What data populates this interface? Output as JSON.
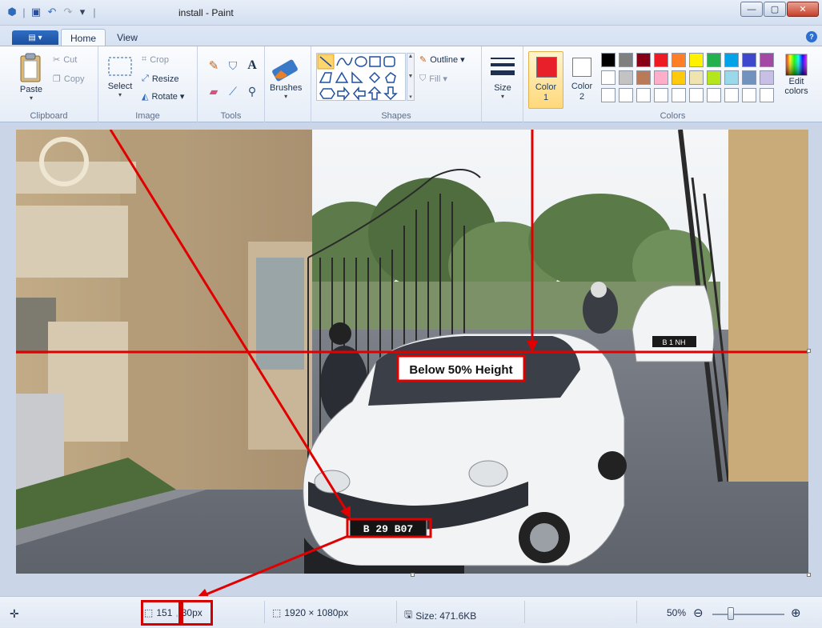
{
  "window": {
    "title": "install - Paint",
    "minimize_glyph": "—",
    "maximize_glyph": "▢",
    "close_glyph": "✕"
  },
  "quick_access": {
    "separator": "|",
    "dropdown_glyph": "▾"
  },
  "tabs": {
    "file_glyph": "▤ ▾",
    "home": "Home",
    "view": "View",
    "help_glyph": "?"
  },
  "ribbon": {
    "clipboard": {
      "group_label": "Clipboard",
      "paste": "Paste",
      "cut": "Cut",
      "copy": "Copy"
    },
    "image": {
      "group_label": "Image",
      "select": "Select",
      "crop": "Crop",
      "resize": "Resize",
      "rotate": "Rotate ▾"
    },
    "tools": {
      "group_label": "Tools",
      "text_glyph": "A"
    },
    "brushes": {
      "label": "Brushes"
    },
    "shapes": {
      "group_label": "Shapes",
      "outline": "Outline ▾",
      "fill": "Fill ▾"
    },
    "size": {
      "label": "Size"
    },
    "colors": {
      "group_label": "Colors",
      "color1_label": "Color",
      "color1_num": "1",
      "color2_label": "Color",
      "color2_num": "2",
      "color1_value": "#e8202a",
      "color2_value": "#ffffff",
      "edit_colors_line1": "Edit",
      "edit_colors_line2": "colors",
      "palette_row1": [
        "#000000",
        "#7f7f7f",
        "#880015",
        "#ed1c24",
        "#ff7f27",
        "#fff200",
        "#22b14c",
        "#00a2e8",
        "#3f48cc",
        "#a349a4"
      ],
      "palette_row2": [
        "#ffffff",
        "#c3c3c3",
        "#b97a57",
        "#ffaec9",
        "#ffc90e",
        "#efe4b0",
        "#b5e61d",
        "#99d9ea",
        "#7092be",
        "#c8bfe7"
      ],
      "palette_row3": [
        "#ffffff",
        "#ffffff",
        "#ffffff",
        "#ffffff",
        "#ffffff",
        "#ffffff",
        "#ffffff",
        "#ffffff",
        "#ffffff",
        "#ffffff"
      ]
    }
  },
  "canvas": {
    "annotation_label": "Below 50% Height",
    "plate_text": "B  29 B07",
    "rear_plate_text": "B 1 NH"
  },
  "statusbar": {
    "move_glyph": "✛",
    "cursor_pos_a": "151",
    "cursor_pos_sep": ",",
    "cursor_pos_b": "30px",
    "image_dimensions": "1920 × 1080px",
    "file_size": "Size: 471.6KB",
    "zoom": "50%",
    "zoom_out_glyph": "⊖",
    "zoom_in_glyph": "⊕",
    "zoom_level": 0.5
  }
}
